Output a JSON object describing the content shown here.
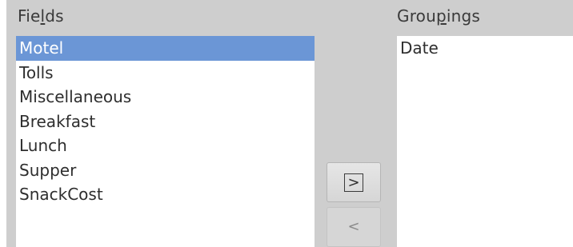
{
  "fields": {
    "label_prefix": "Fie",
    "label_mnemonic": "l",
    "label_suffix": "ds",
    "items": [
      {
        "label": "Motel",
        "selected": true
      },
      {
        "label": "Tolls",
        "selected": false
      },
      {
        "label": "Miscellaneous",
        "selected": false
      },
      {
        "label": "Breakfast",
        "selected": false
      },
      {
        "label": "Lunch",
        "selected": false
      },
      {
        "label": "Supper",
        "selected": false
      },
      {
        "label": "SnackCost",
        "selected": false
      }
    ]
  },
  "groupings": {
    "label_prefix": "Grou",
    "label_mnemonic": "p",
    "label_suffix": "ings",
    "items": [
      {
        "label": "Date"
      }
    ]
  },
  "buttons": {
    "add_label": ">",
    "remove_label": "<"
  },
  "colors": {
    "panel_bg": "#cecece",
    "selection": "#6b96d6",
    "list_bg": "#ffffff"
  }
}
